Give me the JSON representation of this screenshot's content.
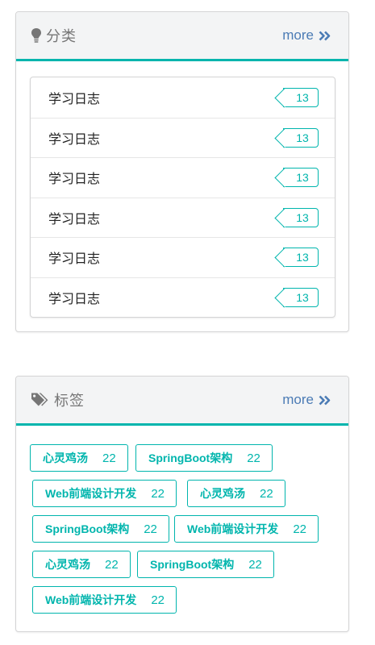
{
  "categories": {
    "title": "分类",
    "more_label": "more",
    "icon": "lightbulb-icon",
    "items": [
      {
        "name": "学习日志",
        "count": "13"
      },
      {
        "name": "学习日志",
        "count": "13"
      },
      {
        "name": "学习日志",
        "count": "13"
      },
      {
        "name": "学习日志",
        "count": "13"
      },
      {
        "name": "学习日志",
        "count": "13"
      },
      {
        "name": "学习日志",
        "count": "13"
      }
    ]
  },
  "tags": {
    "title": "标签",
    "more_label": "more",
    "icon": "tags-icon",
    "items": [
      {
        "name": "心灵鸡汤",
        "count": "22"
      },
      {
        "name": "SpringBoot架构",
        "count": "22"
      },
      {
        "name": "Web前端设计开发",
        "count": "22"
      },
      {
        "name": "心灵鸡汤",
        "count": "22"
      },
      {
        "name": "SpringBoot架构",
        "count": "22"
      },
      {
        "name": "Web前端设计开发",
        "count": "22"
      },
      {
        "name": "心灵鸡汤",
        "count": "22"
      },
      {
        "name": "SpringBoot架构",
        "count": "22"
      },
      {
        "name": "Web前端设计开发",
        "count": "22"
      }
    ]
  },
  "colors": {
    "accent": "#00b5ad",
    "link": "#4b7bb5",
    "header_bg": "#f3f4f5"
  }
}
